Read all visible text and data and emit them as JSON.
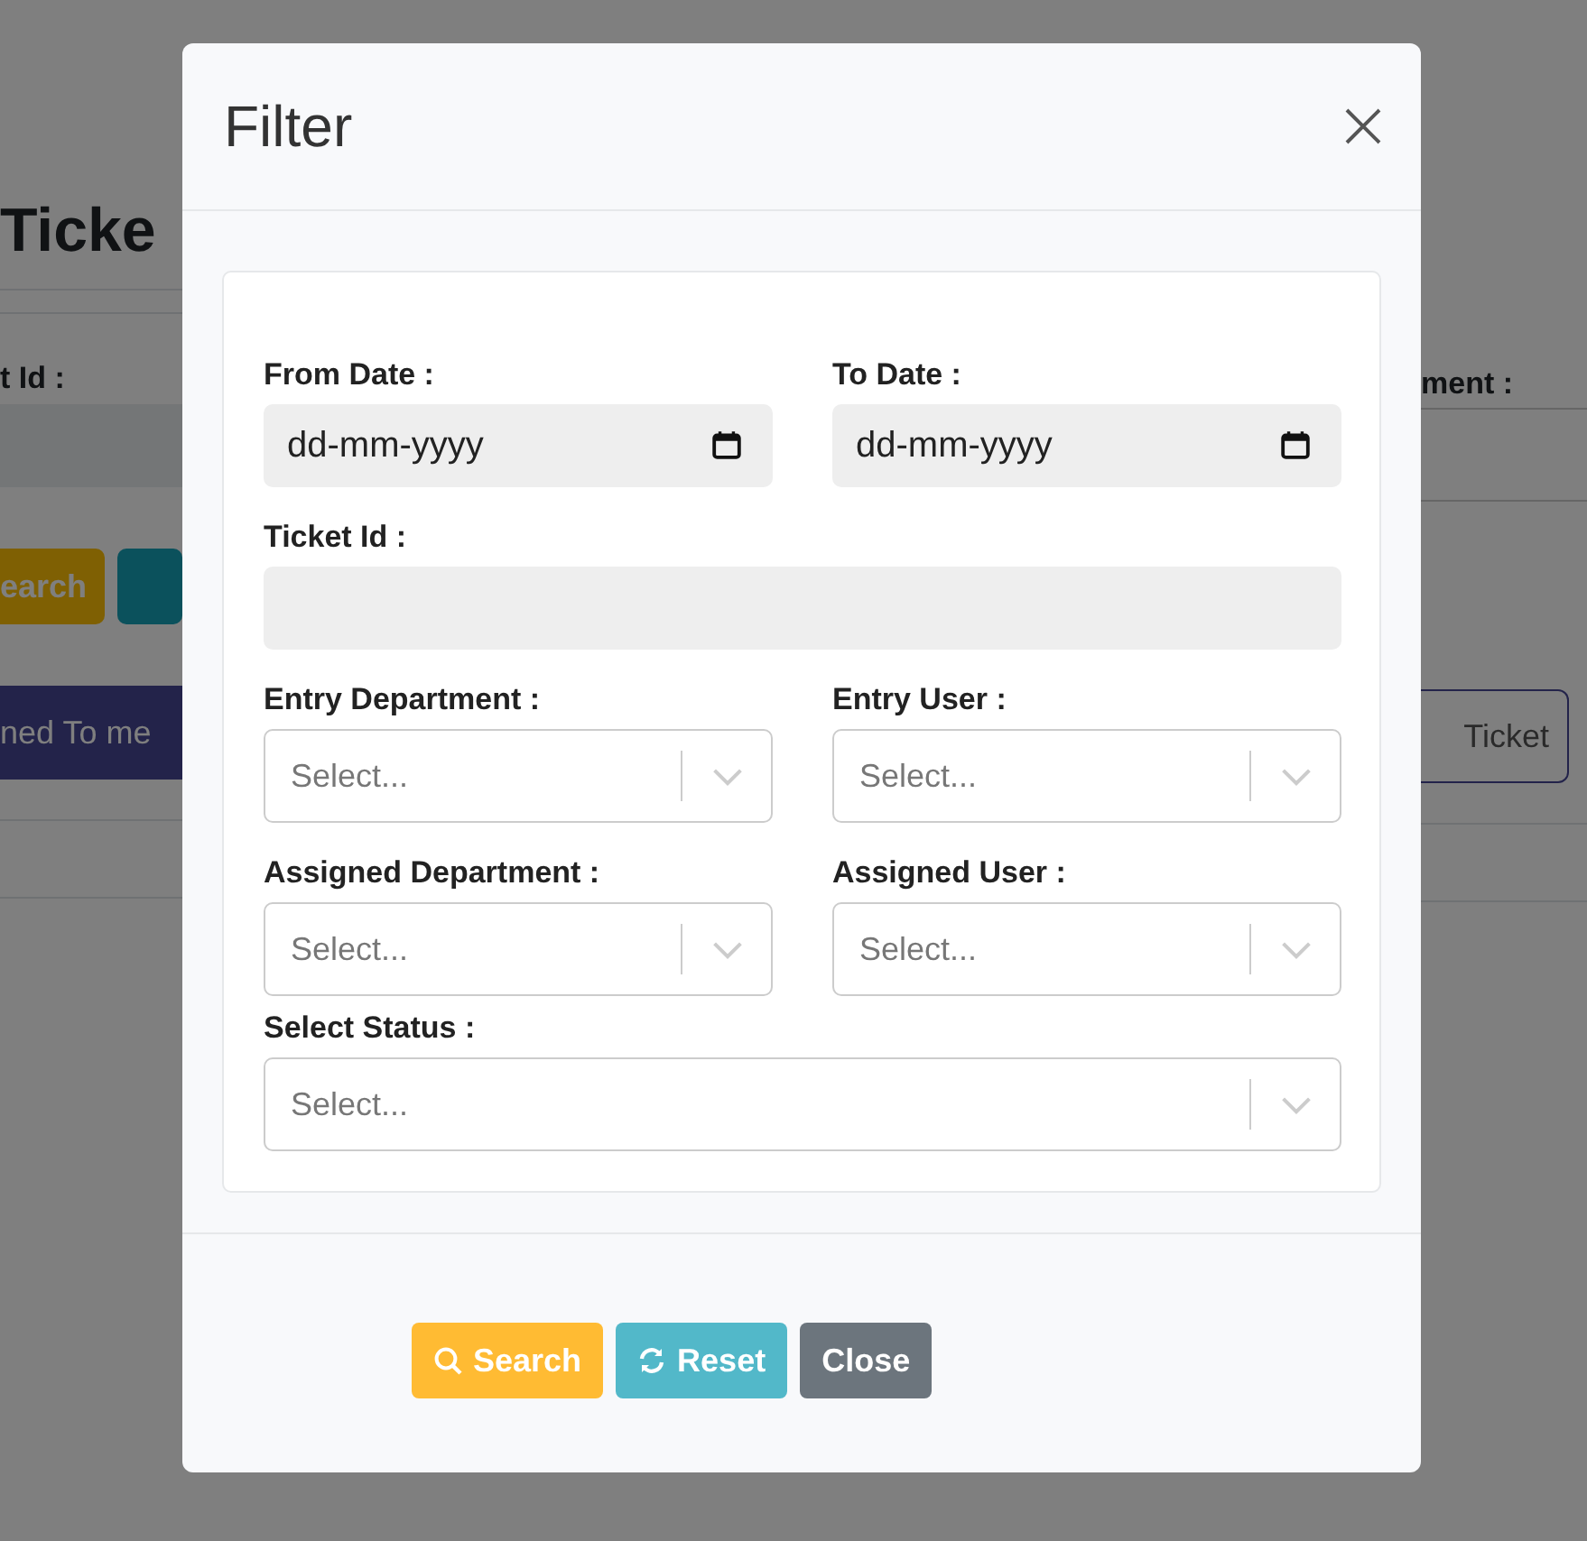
{
  "background": {
    "title": "Ticke",
    "field_label": "t Id :",
    "search_button": "earch",
    "tab_button": "ned To me",
    "right_label": "ment :",
    "right_button": "Ticket"
  },
  "modal": {
    "title": "Filter",
    "rows": [
      {
        "fields": [
          {
            "kind": "date",
            "label": "From Date :",
            "placeholder": "dd-mm-yyyy"
          },
          {
            "kind": "date",
            "label": "To Date :",
            "placeholder": "dd-mm-yyyy"
          }
        ]
      },
      {
        "fields": [
          {
            "kind": "text",
            "label": "Ticket Id :"
          }
        ]
      },
      {
        "fields": [
          {
            "kind": "select",
            "label": "Entry Department :",
            "placeholder": "Select..."
          },
          {
            "kind": "select",
            "label": "Entry User :",
            "placeholder": "Select..."
          }
        ]
      },
      {
        "fields": [
          {
            "kind": "select",
            "label": "Assigned Department :",
            "placeholder": "Select..."
          },
          {
            "kind": "select",
            "label": "Assigned User :",
            "placeholder": "Select..."
          }
        ]
      },
      {
        "fields": [
          {
            "kind": "select",
            "label": "Select Status :",
            "placeholder": "Select..."
          }
        ]
      }
    ],
    "buttons": [
      {
        "kind": "search",
        "label": "Search"
      },
      {
        "kind": "reset",
        "label": "Reset"
      },
      {
        "kind": "close",
        "label": "Close"
      }
    ]
  }
}
